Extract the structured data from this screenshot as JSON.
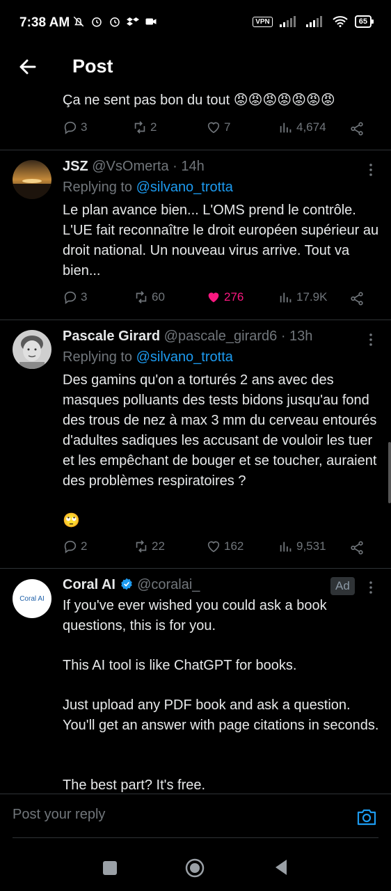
{
  "status_bar": {
    "time": "7:38 AM",
    "vpn": "VPN",
    "battery": "65",
    "icons": [
      "mute-icon",
      "alarm-icon",
      "alarm-icon",
      "dropbox-icon",
      "video-icon",
      "signal-icon",
      "signal-icon",
      "wifi-icon"
    ]
  },
  "header": {
    "title": "Post"
  },
  "posts": [
    {
      "text": "Ça ne sent pas bon du tout 😡😡😡😡😡😡😡",
      "replies": "3",
      "reposts": "2",
      "likes": "7",
      "views": "4,674"
    },
    {
      "name": "JSZ",
      "handle": "@VsOmerta",
      "time": "· 14h",
      "replying_prefix": "Replying to ",
      "replying_to": "@silvano_trotta",
      "text": "Le plan avance bien... L'OMS prend le contrôle. L'UE fait reconnaître le droit européen supérieur au droit national. Un nouveau virus arrive. Tout va bien...",
      "replies": "3",
      "reposts": "60",
      "likes": "276",
      "views": "17.9K",
      "liked": true
    },
    {
      "name": "Pascale Girard",
      "handle": "@pascale_girard6",
      "time": "· 13h",
      "replying_prefix": "Replying to ",
      "replying_to": "@silvano_trotta",
      "text": "Des gamins qu'on a torturés 2 ans avec des masques polluants des tests bidons jusqu'au fond des trous de nez à max 3 mm du cerveau entourés d'adultes sadiques les accusant de vouloir les tuer et les empêchant de bouger et se toucher, auraient des problèmes respiratoires ?",
      "emoji": "🙄",
      "replies": "2",
      "reposts": "22",
      "likes": "162",
      "views": "9,531"
    },
    {
      "name": "Coral AI",
      "handle": "@coralai_",
      "ad_label": "Ad",
      "avatar_label": "Coral AI",
      "paragraphs": [
        "If you've ever wished you could ask a book questions, this is for you.",
        "This AI tool is like ChatGPT for books.",
        "Just upload any PDF book and ask a question. You'll get an answer with page citations in seconds.",
        "The best part? It's free."
      ]
    }
  ],
  "reply_bar": {
    "placeholder": "Post your reply"
  },
  "colors": {
    "accent": "#1d9bf0",
    "like": "#f91880",
    "muted": "#71767b",
    "text": "#e7e9ea"
  }
}
